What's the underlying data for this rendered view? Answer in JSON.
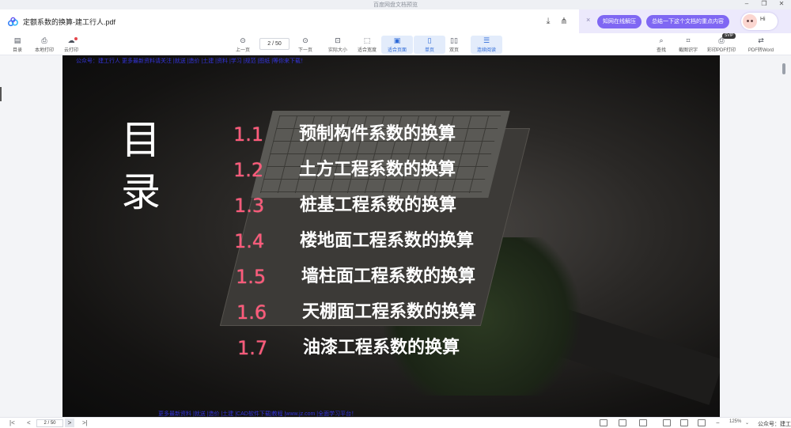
{
  "window": {
    "app_title": "百度网盘文档预览",
    "controls": [
      "–",
      "❐",
      "✕"
    ]
  },
  "document": {
    "title": "定额系数的换算-建工行人.pdf"
  },
  "ai_bar": {
    "btn_unzip": "知网在线解压",
    "btn_summary": "总结一下这个文档的重点内容",
    "avatar_greeting": "Hi"
  },
  "toolbar": {
    "catalog": "目录",
    "local_print": "本地打印",
    "cloud_print": "云打印",
    "prev_page": "上一页",
    "page_current": "2",
    "page_total": "/ 50",
    "next_page": "下一页",
    "actual_size": "实际大小",
    "fit_width": "适合宽度",
    "fit_page": "适合页面",
    "single_page": "单页",
    "double_page": "双页",
    "continuous": "连续阅读",
    "search": "查找",
    "screenshot_ocr": "截图识字",
    "color_print": "彩印PDF打印",
    "vip": "SVIP",
    "pdf_to_word": "PDF转Word"
  },
  "slide": {
    "heading_line1": "目",
    "heading_line2": "录",
    "items": [
      {
        "num": "1.1",
        "text": "预制构件系数的换算"
      },
      {
        "num": "1.2",
        "text": "土方工程系数的换算"
      },
      {
        "num": "1.3",
        "text": "桩基工程系数的换算"
      },
      {
        "num": "1.4",
        "text": "楼地面工程系数的换算"
      },
      {
        "num": "1.5",
        "text": "墙柱面工程系数的换算"
      },
      {
        "num": "1.6",
        "text": "天棚面工程系数的换算"
      },
      {
        "num": "1.7",
        "text": "油漆工程系数的换算"
      }
    ],
    "watermark_top": "公众号：建工行人 更多最新资料请关注 |就送 |造价 |土建 |资料 |学习 |规范 |图纸 |等你来下载！",
    "watermark_bottom": "更多最新资料 |就送 |造价 |土建 |CAD软件下载|教程 |www.jz.com |全面学习平台！"
  },
  "statusbar": {
    "first": "|<",
    "prev": "<",
    "page": "2 / 50",
    "next": ">",
    "last": ">|",
    "zoom": "125%",
    "zoom_caret": "⌄",
    "wechat_label": "公众号：建工行人"
  },
  "colors": {
    "accent_purple": "#7f67f3",
    "toc_number": "#ff5a7a",
    "active_tool": "#2f6bd8"
  }
}
